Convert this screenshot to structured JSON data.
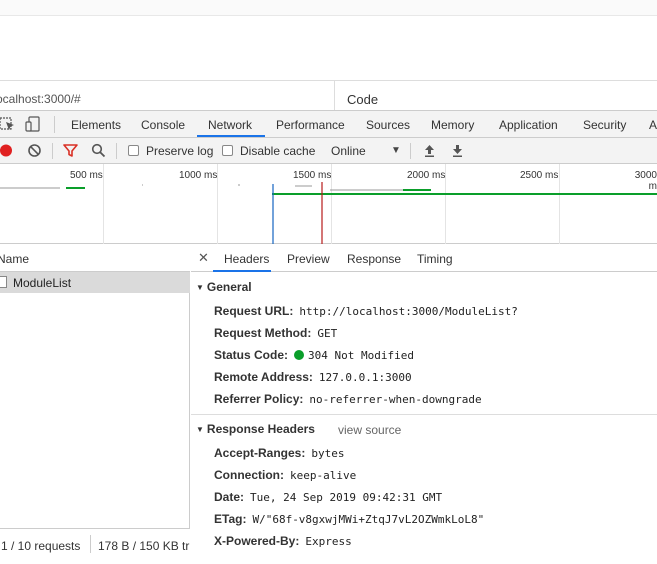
{
  "url_bar": {
    "url": "ocalhost:3000/#",
    "code_label": "Code"
  },
  "devtools_tabs": [
    "Elements",
    "Console",
    "Network",
    "Performance",
    "Sources",
    "Memory",
    "Application",
    "Security",
    "A"
  ],
  "network_toolbar": {
    "preserve_log_label": "Preserve log",
    "disable_cache_label": "Disable cache",
    "throttle_value": "Online"
  },
  "timeline": {
    "ticks": [
      "500 ms",
      "1000 ms",
      "1500 ms",
      "2000 ms",
      "2500 ms",
      "3000 m"
    ]
  },
  "request_list": {
    "header": "Name",
    "items": [
      "ModuleList"
    ],
    "status_requests": "1 / 10 requests",
    "status_transfer": "178 B / 150 KB tr"
  },
  "detail_tabs": [
    "Headers",
    "Preview",
    "Response",
    "Timing"
  ],
  "general": {
    "title": "General",
    "rows": [
      {
        "key": "Request URL:",
        "value": "http://localhost:3000/ModuleList?"
      },
      {
        "key": "Request Method:",
        "value": "GET"
      },
      {
        "key": "Status Code:",
        "value": "304 Not Modified"
      },
      {
        "key": "Remote Address:",
        "value": "127.0.0.1:3000"
      },
      {
        "key": "Referrer Policy:",
        "value": "no-referrer-when-downgrade"
      }
    ]
  },
  "response_headers": {
    "title": "Response Headers",
    "view_source": "view source",
    "rows": [
      {
        "key": "Accept-Ranges:",
        "value": "bytes"
      },
      {
        "key": "Connection:",
        "value": "keep-alive"
      },
      {
        "key": "Date:",
        "value": "Tue, 24 Sep 2019 09:42:31 GMT"
      },
      {
        "key": "ETag:",
        "value": "W/\"68f-v8gxwjMWi+ZtqJ7vL2OZWmkLoL8\""
      },
      {
        "key": "X-Powered-By:",
        "value": "Express"
      }
    ]
  },
  "colors": {
    "accent": "#1a73e8",
    "record": "#e02020",
    "filter": "#d93025",
    "status_ok": "#0a9e2a"
  }
}
